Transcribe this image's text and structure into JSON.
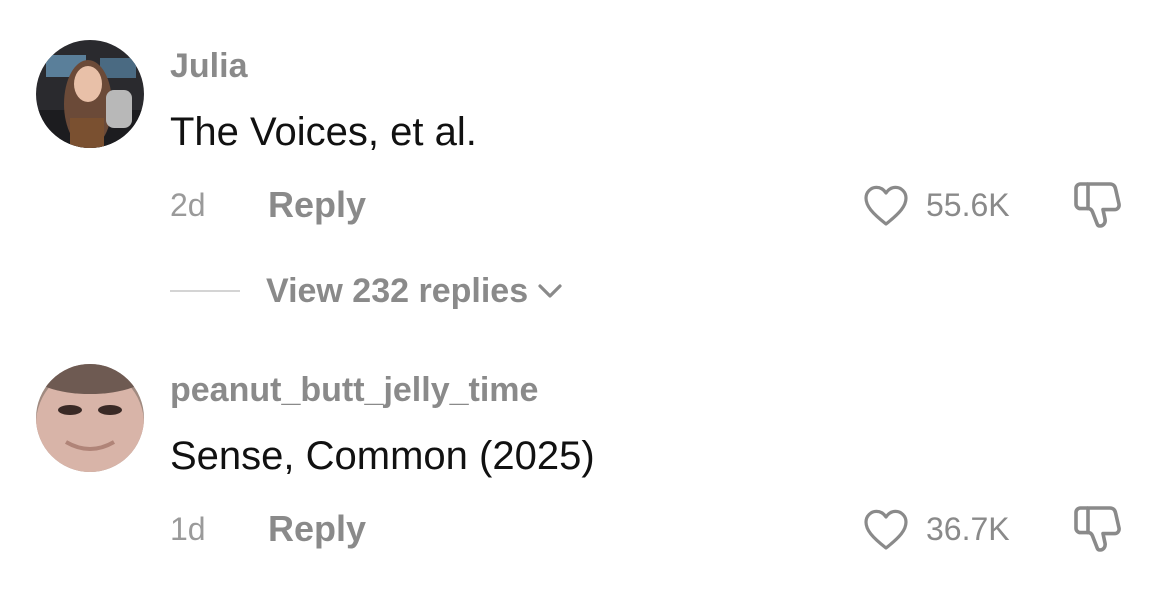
{
  "comments": [
    {
      "username": "Julia",
      "text": "The Voices, et al.",
      "time": "2d",
      "reply_label": "Reply",
      "like_count": "55.6K",
      "view_replies_label": "View 232 replies"
    },
    {
      "username": "peanut_butt_jelly_time",
      "text": "Sense, Common (2025)",
      "time": "1d",
      "reply_label": "Reply",
      "like_count": "36.7K"
    }
  ],
  "icons": {
    "like": "heart-outline-icon",
    "dislike": "thumbs-down-icon",
    "expand": "chevron-down-icon"
  },
  "colors": {
    "username": "#8a8a8a",
    "text": "#111111",
    "meta": "#9a9a9a"
  }
}
